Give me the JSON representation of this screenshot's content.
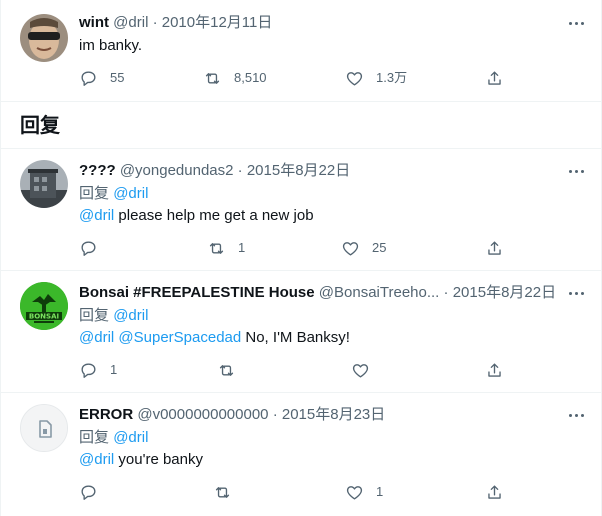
{
  "main_tweet": {
    "name": "wint",
    "handle": "@dril",
    "date": "2010年12月11日",
    "text": "im banky.",
    "replies": "55",
    "retweets": "8,510",
    "likes": "1.3万"
  },
  "section_title": "回复",
  "separator": "·",
  "replying_label": "回复",
  "replies": [
    {
      "name": "????",
      "handle": "@yongedundas2",
      "date": "2015年8月22日",
      "replying_to": "@dril",
      "mention": "@dril",
      "text": " please help me get a new job",
      "reply_count": "",
      "retweet_count": "1",
      "like_count": "25"
    },
    {
      "name": "Bonsai #FREEPALESTINE House",
      "handle": "@BonsaiTreeho...",
      "date": "2015年8月22日",
      "replying_to": "@dril",
      "mention": "@dril",
      "mention2": "@SuperSpacedad",
      "text": " No, I'M Banksy!",
      "reply_count": "1",
      "retweet_count": "",
      "like_count": "",
      "avatar_text": "BONSAI"
    },
    {
      "name": "ERROR",
      "handle": "@v0000000000000",
      "date": "2015年8月23日",
      "replying_to": "@dril",
      "mention": "@dril",
      "text": " you're banky",
      "reply_count": "",
      "retweet_count": "",
      "like_count": "1"
    }
  ],
  "colors": {
    "accent": "#1d9bf0",
    "muted": "#536471",
    "border": "#eff3f4"
  }
}
